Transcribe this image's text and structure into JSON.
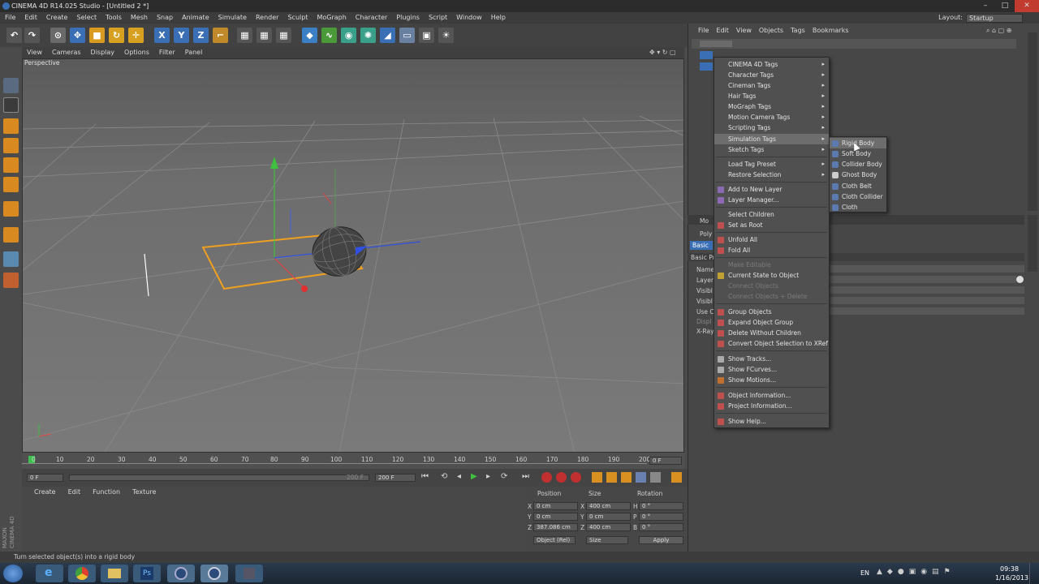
{
  "window": {
    "title": "CINEMA 4D R14.025 Studio - [Untitled 2 *]"
  },
  "menubar": [
    "File",
    "Edit",
    "Create",
    "Select",
    "Tools",
    "Mesh",
    "Snap",
    "Animate",
    "Simulate",
    "Render",
    "Sculpt",
    "MoGraph",
    "Character",
    "Plugins",
    "Script",
    "Window",
    "Help"
  ],
  "layout": {
    "label": "Layout:",
    "value": "Startup"
  },
  "viewport": {
    "menu": [
      "View",
      "Cameras",
      "Display",
      "Options",
      "Filter",
      "Panel"
    ],
    "label": "Perspective"
  },
  "timeline": {
    "ticks": [
      "0",
      "10",
      "20",
      "30",
      "40",
      "50",
      "60",
      "70",
      "80",
      "90",
      "100",
      "110",
      "120",
      "130",
      "140",
      "150",
      "160",
      "170",
      "180",
      "190",
      "200"
    ],
    "end_label": "0 F",
    "start_field": "0 F",
    "end_field": "200 F",
    "range_end": "200 F"
  },
  "material_menu": [
    "Create",
    "Edit",
    "Function",
    "Texture"
  ],
  "coords": {
    "headers": [
      "Position",
      "Size",
      "Rotation"
    ],
    "rows": [
      {
        "axis": "X",
        "pos": "0 cm",
        "size_axis": "X",
        "size": "400 cm",
        "rot_axis": "H",
        "rot": "0 °"
      },
      {
        "axis": "Y",
        "pos": "0 cm",
        "size_axis": "Y",
        "size": "0 cm",
        "rot_axis": "P",
        "rot": "0 °"
      },
      {
        "axis": "Z",
        "pos": "387.086 cm",
        "size_axis": "Z",
        "size": "400 cm",
        "rot_axis": "B",
        "rot": "0 °"
      }
    ],
    "mode": "Object (Rel)",
    "size_mode": "Size",
    "apply": "Apply"
  },
  "object_menu": [
    "File",
    "Edit",
    "View",
    "Objects",
    "Tags",
    "Bookmarks"
  ],
  "attributes": {
    "tab_basic": "Basic",
    "section": "Basic Pr",
    "rows": [
      "Name",
      "Layer",
      "Visibl",
      "Visibl",
      "Use C",
      "Displ",
      "X-Ray"
    ],
    "mode_label": "Mo",
    "poly_label": "Poly"
  },
  "context_menu": {
    "items": [
      {
        "label": "CINEMA 4D Tags",
        "arrow": true
      },
      {
        "label": "Character Tags",
        "arrow": true
      },
      {
        "label": "Cineman Tags",
        "arrow": true
      },
      {
        "label": "Hair Tags",
        "arrow": true
      },
      {
        "label": "MoGraph Tags",
        "arrow": true
      },
      {
        "label": "Motion Camera Tags",
        "arrow": true
      },
      {
        "label": "Scripting Tags",
        "arrow": true
      },
      {
        "label": "Simulation Tags",
        "arrow": true,
        "highlight": true
      },
      {
        "label": "Sketch Tags",
        "arrow": true
      },
      {
        "label": "Load Tag Preset",
        "arrow": true
      },
      {
        "label": "Restore Selection",
        "arrow": true
      },
      {
        "label": "Add to New Layer"
      },
      {
        "label": "Layer Manager..."
      },
      {
        "label": "Select Children"
      },
      {
        "label": "Set as Root"
      },
      {
        "label": "Unfold All"
      },
      {
        "label": "Fold All"
      },
      {
        "label": "Make Editable",
        "disabled": true
      },
      {
        "label": "Current State to Object"
      },
      {
        "label": "Connect Objects",
        "disabled": true
      },
      {
        "label": "Connect Objects + Delete",
        "disabled": true
      },
      {
        "label": "Group Objects"
      },
      {
        "label": "Expand Object Group"
      },
      {
        "label": "Delete Without Children"
      },
      {
        "label": "Convert Object Selection to XRef"
      },
      {
        "label": "Show Tracks..."
      },
      {
        "label": "Show FCurves..."
      },
      {
        "label": "Show Motions..."
      },
      {
        "label": "Object Information..."
      },
      {
        "label": "Project Information..."
      },
      {
        "label": "Show Help..."
      }
    ]
  },
  "submenu": {
    "items": [
      {
        "label": "Rigid Body",
        "highlight": true
      },
      {
        "label": "Soft Body"
      },
      {
        "label": "Collider Body"
      },
      {
        "label": "Ghost Body"
      },
      {
        "label": "Cloth Belt"
      },
      {
        "label": "Cloth Collider"
      },
      {
        "label": "Cloth"
      }
    ]
  },
  "statusbar": {
    "text": "Turn selected object(s) into a rigid body"
  },
  "taskbar": {
    "lang": "EN",
    "time": "09:38",
    "date": "1/16/2013"
  },
  "brand": {
    "line1": "MAXON",
    "line2": "CINEMA 4D"
  }
}
